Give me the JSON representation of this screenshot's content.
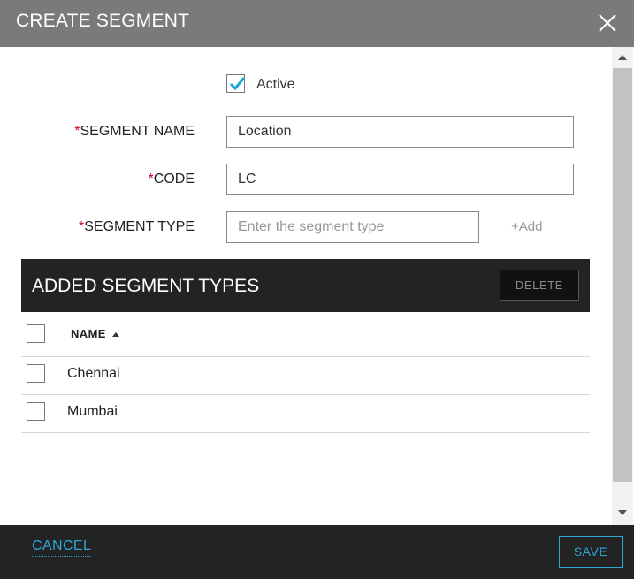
{
  "dialog": {
    "title": "CREATE SEGMENT",
    "close_icon": "close-icon"
  },
  "form": {
    "active": {
      "label": "Active",
      "checked": true
    },
    "required_marker": "*",
    "segment_name": {
      "label": "SEGMENT NAME",
      "value": "Location"
    },
    "code": {
      "label": "CODE",
      "value": "LC"
    },
    "segment_type": {
      "label": "SEGMENT TYPE",
      "value": "",
      "placeholder": "Enter the segment type"
    },
    "add_label": "+Add"
  },
  "segment_types": {
    "title": "ADDED SEGMENT TYPES",
    "delete_label": "DELETE",
    "column_name": "NAME",
    "sort": "ascending",
    "rows": [
      {
        "name": "Chennai",
        "checked": false
      },
      {
        "name": "Mumbai",
        "checked": false
      }
    ]
  },
  "footer": {
    "cancel_label": "CANCEL",
    "save_label": "SAVE"
  },
  "colors": {
    "header_bg": "#7a7a7a",
    "dark_bar": "#232323",
    "accent": "#2aa8d6",
    "required": "#d0021b",
    "check": "#1fa5d8"
  }
}
